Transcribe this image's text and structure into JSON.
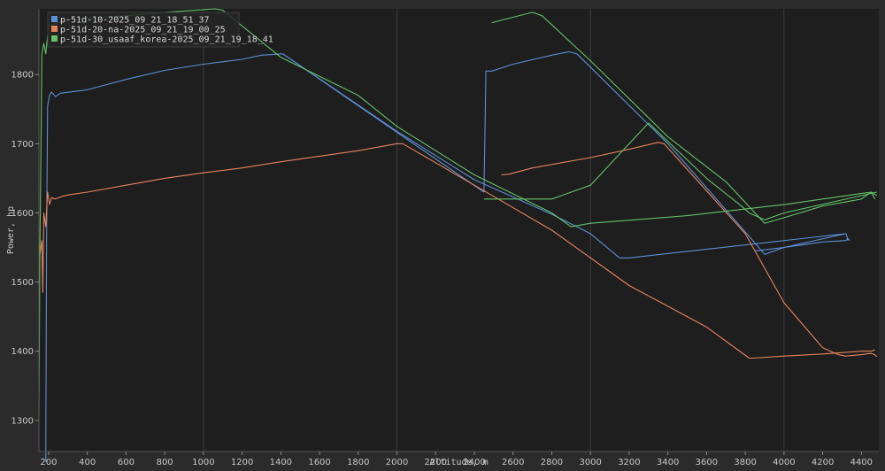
{
  "chart_data": {
    "type": "line",
    "title": "",
    "xlabel": "Altitude, m",
    "ylabel": "Power, hp",
    "xlim": [
      150,
      4490
    ],
    "ylim": [
      1255,
      1895
    ],
    "xticks": [
      200,
      400,
      600,
      800,
      1000,
      1200,
      1400,
      1600,
      1800,
      2000,
      2200,
      2400,
      2600,
      2800,
      3000,
      3200,
      3400,
      3600,
      3800,
      4000,
      4200,
      4400
    ],
    "yticks": [
      1300,
      1400,
      1500,
      1600,
      1700,
      1800
    ],
    "grid": true,
    "legend_position": "top-left",
    "series": [
      {
        "name": "p-51d-10-2025_09_21_18_51_37",
        "color": "#5b8fd6",
        "segments": [
          [
            [
              185,
              1240
            ],
            [
              190,
              1575
            ],
            [
              195,
              1755
            ],
            [
              205,
              1770
            ],
            [
              215,
              1775
            ],
            [
              235,
              1768
            ],
            [
              260,
              1773
            ],
            [
              400,
              1778
            ],
            [
              600,
              1793
            ],
            [
              800,
              1806
            ],
            [
              1000,
              1815
            ],
            [
              1200,
              1822
            ],
            [
              1300,
              1828
            ],
            [
              1410,
              1830
            ],
            [
              2450,
              1630
            ]
          ],
          [
            [
              2450,
              1630
            ],
            [
              2460,
              1805
            ],
            [
              2490,
              1805
            ],
            [
              2600,
              1815
            ],
            [
              2800,
              1828
            ],
            [
              2890,
              1833
            ],
            [
              2930,
              1830
            ],
            [
              3400,
              1700
            ],
            [
              3870,
              1550
            ],
            [
              3900,
              1540
            ],
            [
              4000,
              1550
            ],
            [
              4200,
              1558
            ],
            [
              4320,
              1560
            ],
            [
              4330,
              1563
            ],
            [
              4340,
              1560
            ]
          ],
          [
            [
              3850,
              1545
            ],
            [
              4000,
              1550
            ],
            [
              4320,
              1570
            ],
            [
              4325,
              1567
            ],
            [
              4330,
              1560
            ]
          ],
          [
            [
              1410,
              1830
            ],
            [
              2000,
              1718
            ],
            [
              2400,
              1648
            ],
            [
              2800,
              1598
            ],
            [
              3000,
              1570
            ],
            [
              3150,
              1535
            ],
            [
              3200,
              1535
            ],
            [
              4320,
              1570
            ]
          ]
        ]
      },
      {
        "name": "p-51d-20-na-2025_09_21_19_00_25",
        "color": "#e8845c",
        "segments": [
          [
            [
              155,
              1540
            ],
            [
              165,
              1560
            ],
            [
              170,
              1485
            ],
            [
              175,
              1600
            ],
            [
              185,
              1580
            ],
            [
              195,
              1630
            ],
            [
              205,
              1612
            ],
            [
              215,
              1622
            ],
            [
              235,
              1620
            ],
            [
              270,
              1624
            ],
            [
              300,
              1626
            ],
            [
              400,
              1630
            ],
            [
              600,
              1640
            ],
            [
              800,
              1650
            ],
            [
              1000,
              1658
            ],
            [
              1200,
              1665
            ],
            [
              1400,
              1674
            ],
            [
              1600,
              1682
            ],
            [
              1800,
              1690
            ],
            [
              2000,
              1700
            ],
            [
              2030,
              1700
            ],
            [
              2400,
              1640
            ],
            [
              2800,
              1575
            ],
            [
              3200,
              1495
            ],
            [
              3600,
              1435
            ],
            [
              3820,
              1390
            ],
            [
              3840,
              1390
            ],
            [
              4000,
              1393
            ],
            [
              4200,
              1396
            ],
            [
              4400,
              1400
            ],
            [
              4450,
              1400
            ],
            [
              4470,
              1402
            ]
          ],
          [
            [
              2540,
              1655
            ],
            [
              2580,
              1656
            ],
            [
              2700,
              1665
            ],
            [
              3000,
              1680
            ],
            [
              3200,
              1692
            ],
            [
              3350,
              1702
            ],
            [
              3380,
              1700
            ],
            [
              3800,
              1570
            ],
            [
              4000,
              1470
            ],
            [
              4200,
              1405
            ],
            [
              4280,
              1395
            ],
            [
              4320,
              1393
            ],
            [
              4400,
              1395
            ],
            [
              4450,
              1397
            ],
            [
              4470,
              1395
            ],
            [
              4480,
              1392
            ]
          ]
        ]
      },
      {
        "name": "p-51d-30_usaaf_korea-2025_09_21_19_18_41",
        "color": "#63c266",
        "segments": [
          [
            [
              150,
              1305
            ],
            [
              155,
              1555
            ],
            [
              160,
              1680
            ],
            [
              165,
              1830
            ],
            [
              175,
              1845
            ],
            [
              185,
              1830
            ],
            [
              200,
              1870
            ],
            [
              300,
              1880
            ],
            [
              600,
              1885
            ],
            [
              800,
              1890
            ],
            [
              1060,
              1895
            ],
            [
              1100,
              1893
            ],
            [
              1400,
              1825
            ],
            [
              1800,
              1770
            ],
            [
              2000,
              1725
            ],
            [
              2400,
              1655
            ],
            [
              2800,
              1600
            ],
            [
              2900,
              1580
            ],
            [
              3000,
              1585
            ],
            [
              3500,
              1596
            ],
            [
              4000,
              1612
            ],
            [
              4200,
              1620
            ],
            [
              4400,
              1628
            ],
            [
              4450,
              1630
            ],
            [
              4480,
              1625
            ]
          ],
          [
            [
              2490,
              1875
            ],
            [
              2700,
              1890
            ],
            [
              2750,
              1885
            ],
            [
              3000,
              1820
            ],
            [
              3400,
              1710
            ],
            [
              3700,
              1645
            ],
            [
              3850,
              1600
            ],
            [
              3900,
              1585
            ],
            [
              4000,
              1593
            ],
            [
              4200,
              1610
            ],
            [
              4300,
              1615
            ],
            [
              4400,
              1620
            ],
            [
              4450,
              1630
            ],
            [
              4470,
              1620
            ]
          ],
          [
            [
              2450,
              1620
            ],
            [
              2800,
              1620
            ],
            [
              3000,
              1640
            ],
            [
              3300,
              1730
            ],
            [
              3600,
              1650
            ],
            [
              3780,
              1610
            ],
            [
              3820,
              1600
            ],
            [
              3900,
              1590
            ],
            [
              4000,
              1600
            ],
            [
              4480,
              1630
            ]
          ]
        ]
      }
    ]
  }
}
